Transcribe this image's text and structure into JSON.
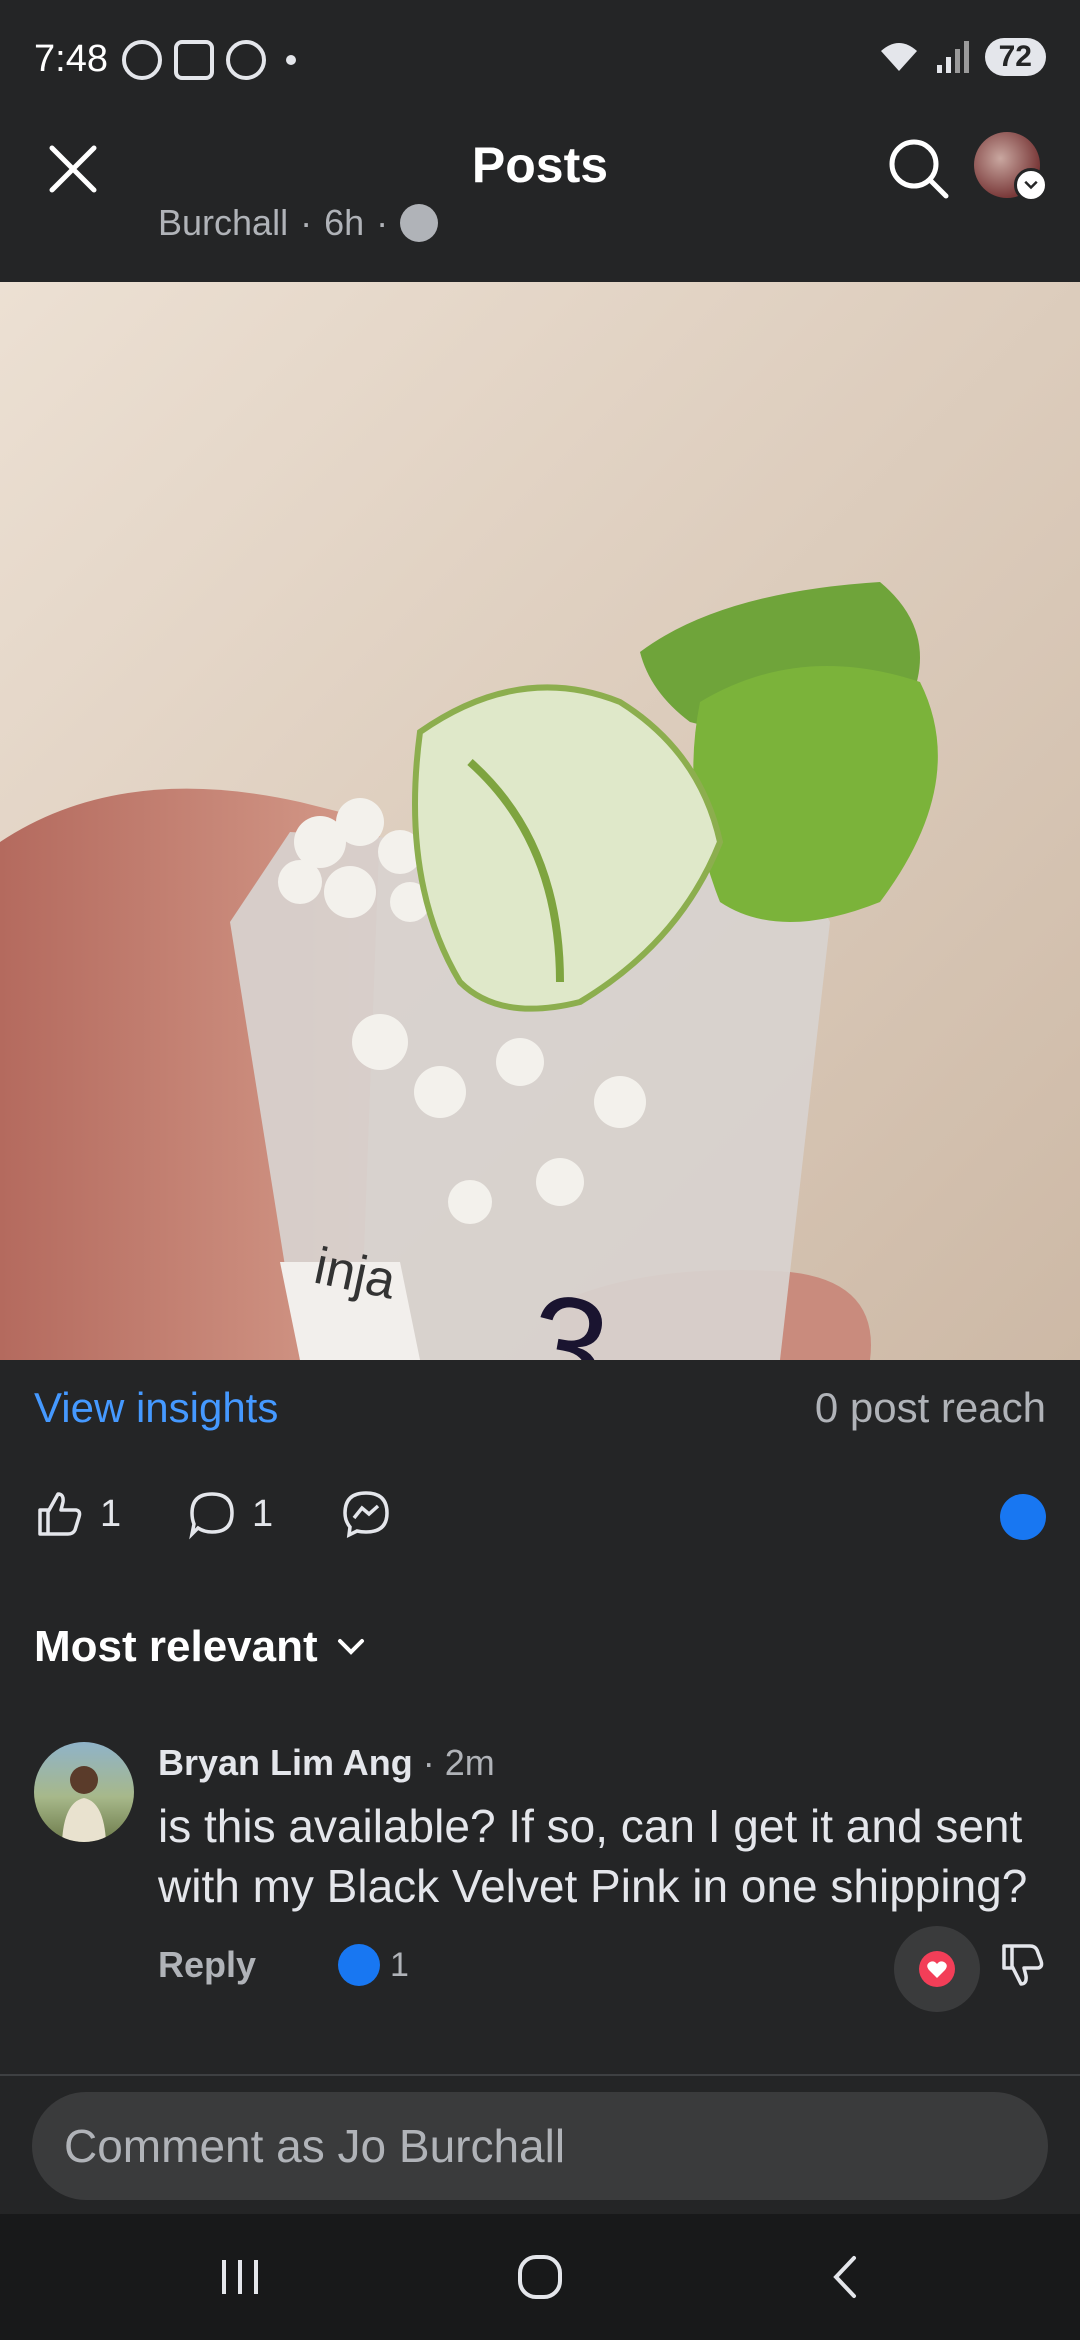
{
  "status_bar": {
    "time": "7:48",
    "battery": "72"
  },
  "header": {
    "title": "Posts",
    "author_peek": "Burchall",
    "timestamp_peek": "6h",
    "separator": "·"
  },
  "insights": {
    "view_insights": "View insights",
    "post_reach": "0 post reach"
  },
  "actions": {
    "like_count": "1",
    "comment_count": "1"
  },
  "sort": {
    "label": "Most relevant"
  },
  "comment": {
    "author": "Bryan Lim Ang",
    "time": " · 2m",
    "text": "is this available? If so, can I get it and sent with my Black Velvet Pink in one shipping?",
    "reply_label": "Reply",
    "like_count": "1"
  },
  "composer": {
    "placeholder": "Comment as Jo Burchall"
  },
  "photo": {
    "label": "3",
    "pot_text": "inja"
  },
  "colors": {
    "accent": "#4599ff",
    "like_blue": "#1877f2",
    "love_red": "#f33e58",
    "background": "#242526"
  }
}
